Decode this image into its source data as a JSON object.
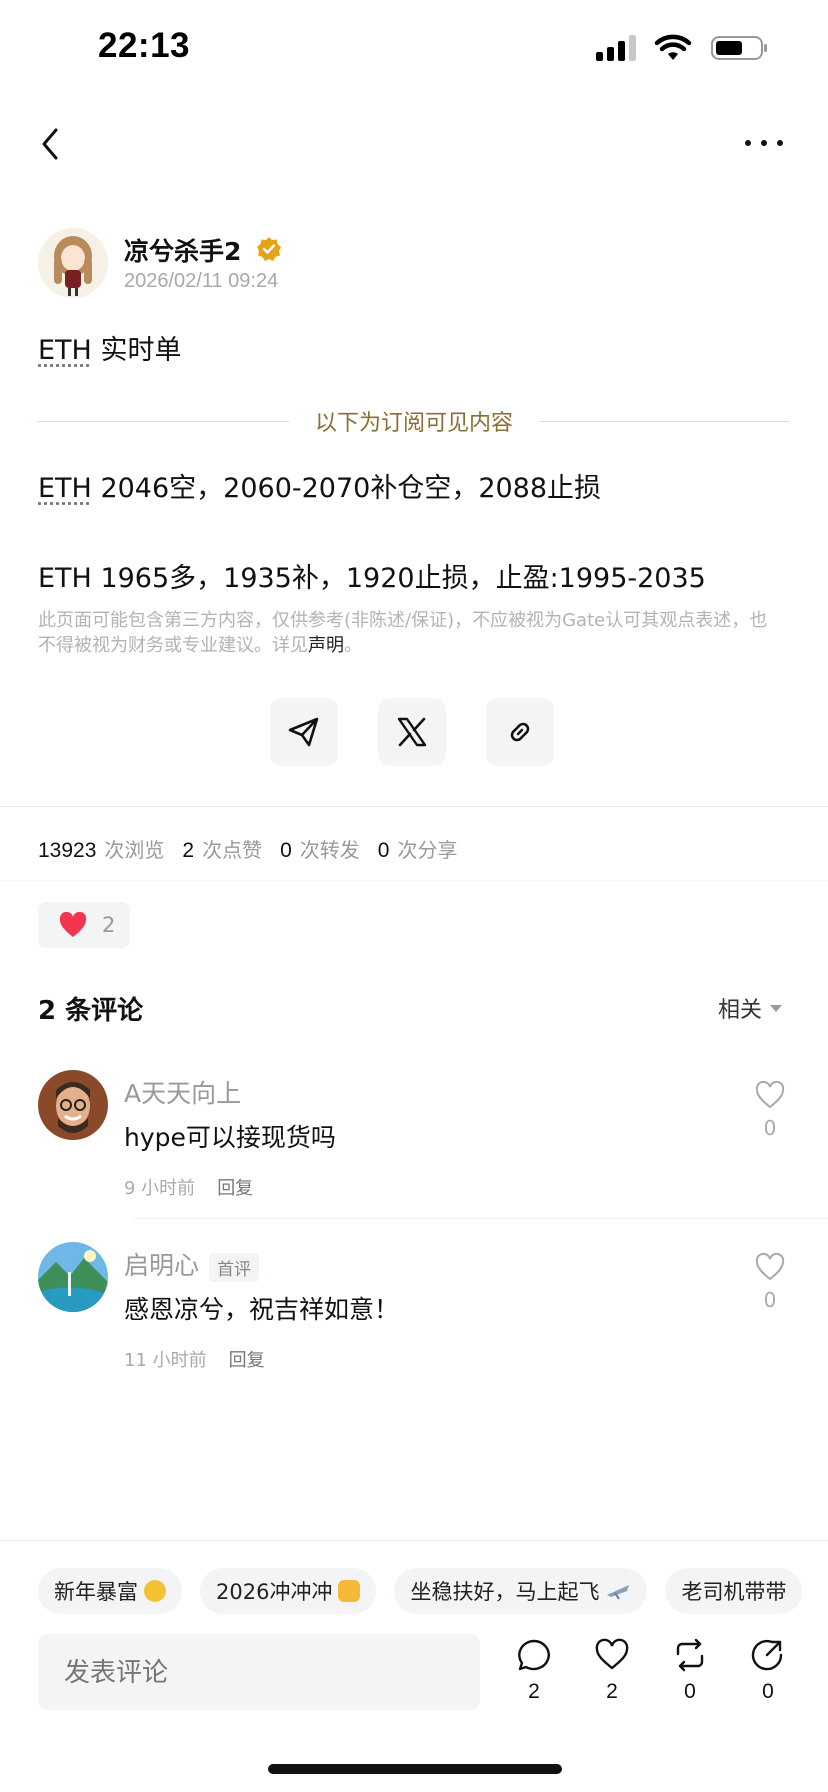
{
  "status": {
    "time": "22:13"
  },
  "author": {
    "name": "凉兮杀手2",
    "timestamp": "2026/02/11 09:24"
  },
  "post": {
    "title_ticker": "ETH",
    "title_rest": " 实时单",
    "divider_label": "以下为订阅可见内容",
    "line1_ticker": "ETH",
    "line1_rest": " 2046空，2060-2070补仓空，2088止损",
    "line2": "ETH 1965多，1935补，1920止损，止盈:1995-2035",
    "disclaimer": "此页面可能包含第三方内容，仅供参考(非陈述/保证)，不应被视为Gate认可其观点表述，也不得被视为财务或专业建议。详见",
    "disclaimer_link": "声明",
    "disclaimer_end": "。"
  },
  "stats": {
    "views": "13923",
    "views_label": "次浏览",
    "likes": "2",
    "likes_label": "次点赞",
    "reposts": "0",
    "reposts_label": "次转发",
    "shares": "0",
    "shares_label": "次分享"
  },
  "reaction": {
    "count": "2"
  },
  "comments_section": {
    "title": "2 条评论",
    "sort_label": "相关"
  },
  "comments": [
    {
      "name": "A天天向上",
      "badge": "",
      "text": "hype可以接现货吗",
      "time": "9 小时前",
      "reply": "回复",
      "likes": "0"
    },
    {
      "name": "启明心",
      "badge": "首评",
      "text": "感恩凉兮，祝吉祥如意！",
      "time": "11 小时前",
      "reply": "回复",
      "likes": "0"
    }
  ],
  "chips": [
    "新年暴富",
    "2026冲冲冲",
    "坐稳扶好，马上起飞",
    "老司机带带"
  ],
  "input": {
    "placeholder": "发表评论"
  },
  "actions": {
    "comments": "2",
    "likes": "2",
    "reposts": "0",
    "shares": "0"
  },
  "colors": {
    "accent": "#8a6e32",
    "verified": "#e3a514",
    "heart": "#f2364f"
  }
}
